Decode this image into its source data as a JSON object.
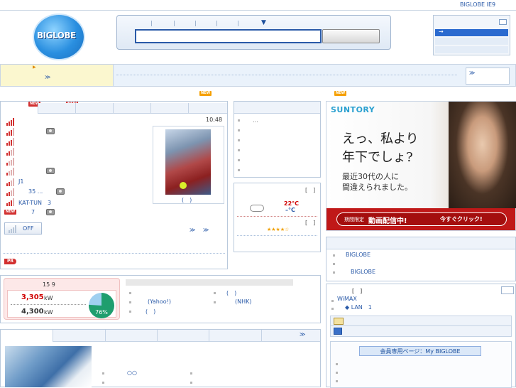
{
  "top_link": "BIGLOBE IE9",
  "logo_text": "BIGLOBE",
  "search": {
    "dropdown_glyph": "▼"
  },
  "side_panel": {
    "arrow": "→"
  },
  "notice": {
    "triangle": "▶",
    "more": "≫",
    "right_more": "≫"
  },
  "badges": {
    "new": "NEW"
  },
  "news": {
    "time": "10:48",
    "photo_caption": "(　)",
    "items": [
      {
        "text": "J1"
      },
      {
        "text": "35 ..."
      },
      {
        "text": "KAT-TUN　3"
      },
      {
        "text": "7"
      }
    ],
    "off_button": "OFF",
    "more1": "≫",
    "more2": "≫",
    "pr": "PR"
  },
  "topics": {
    "first_item": "..."
  },
  "weather": {
    "bracket1": "[　]",
    "high": "22°C",
    "low": "–°C",
    "bracket2": "[　]",
    "stars": "★★★★☆"
  },
  "ad": {
    "brand": "SUNTORY",
    "headline1": "えっ、私より",
    "headline2": "年下でしょ?",
    "sub1": "最近30代の人に",
    "sub2": "間違えられました。",
    "cta_prefix": "期間限定",
    "cta_main": "動画配信中!",
    "cta_button": "今すぐクリック!"
  },
  "right_links": {
    "link1": "BIGLOBE",
    "link2": "BIGLOBE"
  },
  "right_list": {
    "bracket": "[　]",
    "wimax": "WiMAX",
    "lan": "◆ LAN　1"
  },
  "member": {
    "button": "会員専用ページ：My BIGLOBE"
  },
  "power": {
    "title": "15 9",
    "usage_value": "3,305",
    "usage_unit": "kW",
    "capacity_value": "4,300",
    "capacity_unit": "kW",
    "percent_label": "76%",
    "percent": 76
  },
  "links_mid": {
    "left": [
      "",
      "(Yahoo!)",
      "(　)"
    ],
    "right": [
      "(　)",
      "(NHK)"
    ]
  },
  "bottom": {
    "more": "≫",
    "item": "○○"
  },
  "colors": {
    "accent": "#2a5aa8",
    "gauge": "#1f9e6e",
    "ad_red": "#c01818"
  }
}
